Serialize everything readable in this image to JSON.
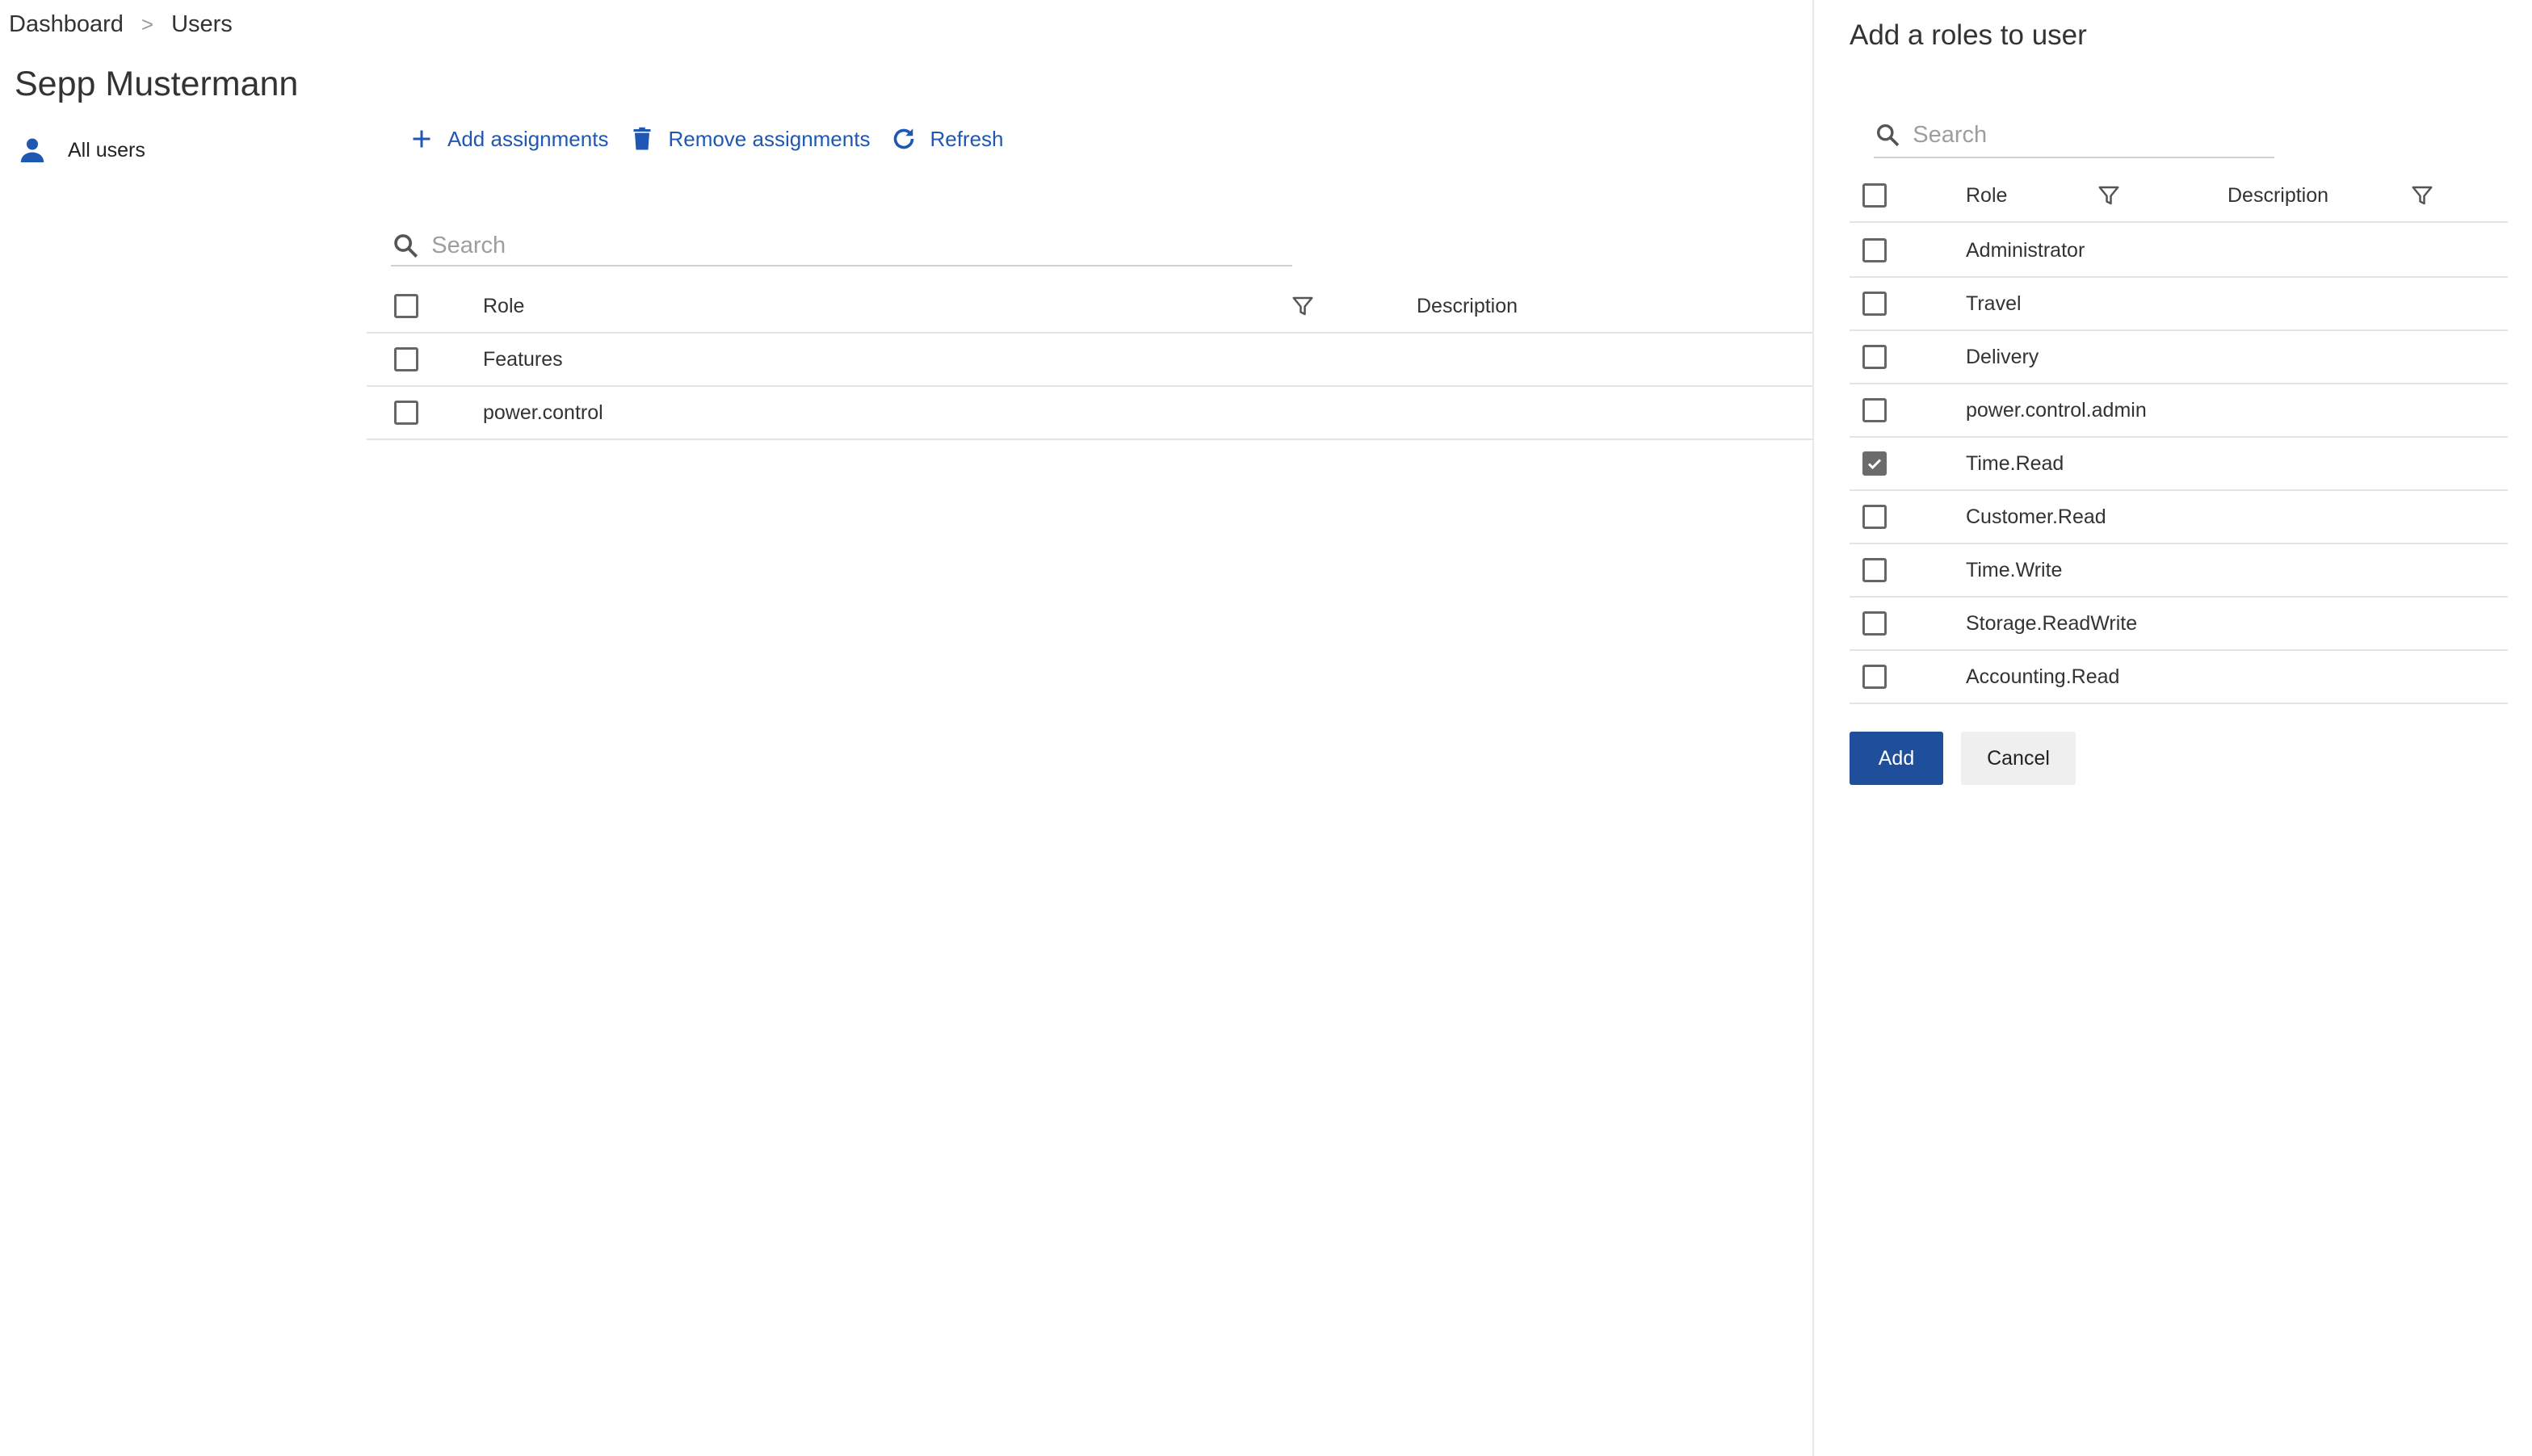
{
  "breadcrumb": {
    "items": [
      "Dashboard",
      "Users"
    ],
    "separator": ">"
  },
  "page_title": "Sepp Mustermann",
  "nav": {
    "all_users": "All users"
  },
  "toolbar": {
    "add": "Add assignments",
    "remove": "Remove assignments",
    "refresh": "Refresh"
  },
  "main_search": {
    "placeholder": "Search"
  },
  "main_table": {
    "columns": {
      "role": "Role",
      "description": "Description"
    },
    "rows": [
      {
        "role": "Features",
        "checked": false
      },
      {
        "role": "power.control",
        "checked": false
      }
    ]
  },
  "panel": {
    "title": "Add a roles to user",
    "search_placeholder": "Search",
    "columns": {
      "role": "Role",
      "description": "Description"
    },
    "rows": [
      {
        "role": "Administrator",
        "checked": false
      },
      {
        "role": "Travel",
        "checked": false
      },
      {
        "role": "Delivery",
        "checked": false
      },
      {
        "role": "power.control.admin",
        "checked": false
      },
      {
        "role": "Time.Read",
        "checked": true
      },
      {
        "role": "Customer.Read",
        "checked": false
      },
      {
        "role": "Time.Write",
        "checked": false
      },
      {
        "role": "Storage.ReadWrite",
        "checked": false
      },
      {
        "role": "Accounting.Read",
        "checked": false
      }
    ],
    "add_label": "Add",
    "cancel_label": "Cancel"
  },
  "colors": {
    "accent": "#2057b3",
    "primary_button": "#1f4e9a",
    "checkbox_checked": "#6b6b6b"
  },
  "icons": {
    "nav": "person-icon",
    "add": "plus-icon",
    "remove": "trash-icon",
    "refresh": "refresh-icon",
    "search": "search-icon",
    "filter": "filter-icon",
    "check": "check-icon"
  }
}
